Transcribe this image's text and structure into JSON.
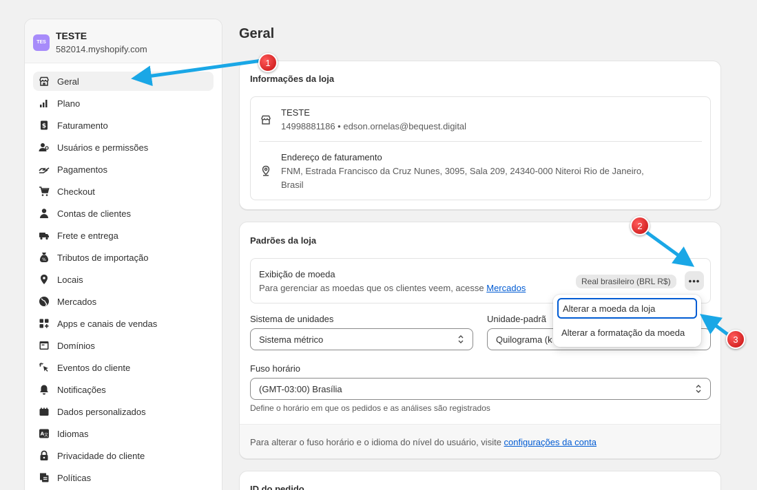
{
  "store": {
    "avatar": "TES",
    "name": "TESTE",
    "domain": "582014.myshopify.com"
  },
  "sidebar": {
    "items": [
      {
        "label": "Geral",
        "icon": "store-icon",
        "active": true
      },
      {
        "label": "Plano",
        "icon": "chart-icon"
      },
      {
        "label": "Faturamento",
        "icon": "dollar-icon"
      },
      {
        "label": "Usuários e permissões",
        "icon": "users-icon"
      },
      {
        "label": "Pagamentos",
        "icon": "payment-icon"
      },
      {
        "label": "Checkout",
        "icon": "cart-icon"
      },
      {
        "label": "Contas de clientes",
        "icon": "person-icon"
      },
      {
        "label": "Frete e entrega",
        "icon": "truck-icon"
      },
      {
        "label": "Tributos de importação",
        "icon": "duties-icon"
      },
      {
        "label": "Locais",
        "icon": "location-icon"
      },
      {
        "label": "Mercados",
        "icon": "globe-icon"
      },
      {
        "label": "Apps e canais de vendas",
        "icon": "apps-icon"
      },
      {
        "label": "Domínios",
        "icon": "domain-icon"
      },
      {
        "label": "Eventos do cliente",
        "icon": "cursor-icon"
      },
      {
        "label": "Notificações",
        "icon": "bell-icon"
      },
      {
        "label": "Dados personalizados",
        "icon": "data-icon"
      },
      {
        "label": "Idiomas",
        "icon": "language-icon"
      },
      {
        "label": "Privacidade do cliente",
        "icon": "lock-icon"
      },
      {
        "label": "Políticas",
        "icon": "policy-icon"
      }
    ]
  },
  "page": {
    "title": "Geral"
  },
  "store_info": {
    "title": "Informações da loja",
    "name": "TESTE",
    "contact": "14998881186 • edson.ornelas@bequest.digital",
    "billing_label": "Endereço de faturamento",
    "billing_line1": "FNM, Estrada Francisco da Cruz Nunes, 3095, Sala 209, 24340-000 Niteroi Rio de Janeiro,",
    "billing_line2": "Brasil"
  },
  "store_defaults": {
    "title": "Padrões da loja",
    "currency_label": "Exibição de moeda",
    "currency_help": "Para gerenciar as moedas que os clientes veem, acesse ",
    "currency_link": "Mercados",
    "currency_badge": "Real brasileiro (BRL R$)",
    "more_label": "•••",
    "units_label": "Sistema de unidades",
    "units_value": "Sistema métrico",
    "weight_label": "Unidade-padrã",
    "weight_value": "Quilograma (k",
    "tz_label": "Fuso horário",
    "tz_value": "(GMT-03:00) Brasília",
    "tz_help": "Define o horário em que os pedidos e as análises são registrados",
    "footer_text": "Para alterar o fuso horário e o idioma do nível do usuário, visite ",
    "footer_link": "configurações da conta"
  },
  "dropdown": {
    "items": [
      "Alterar a moeda da loja",
      "Alterar a formatação da moeda"
    ]
  },
  "order_id": {
    "title": "ID do pedido"
  },
  "markers": [
    "1",
    "2",
    "3"
  ],
  "colors": {
    "accent": "#005bd3",
    "marker": "#d21f1f",
    "arrow": "#1aa7e6",
    "avatar": "#a78bfa"
  }
}
